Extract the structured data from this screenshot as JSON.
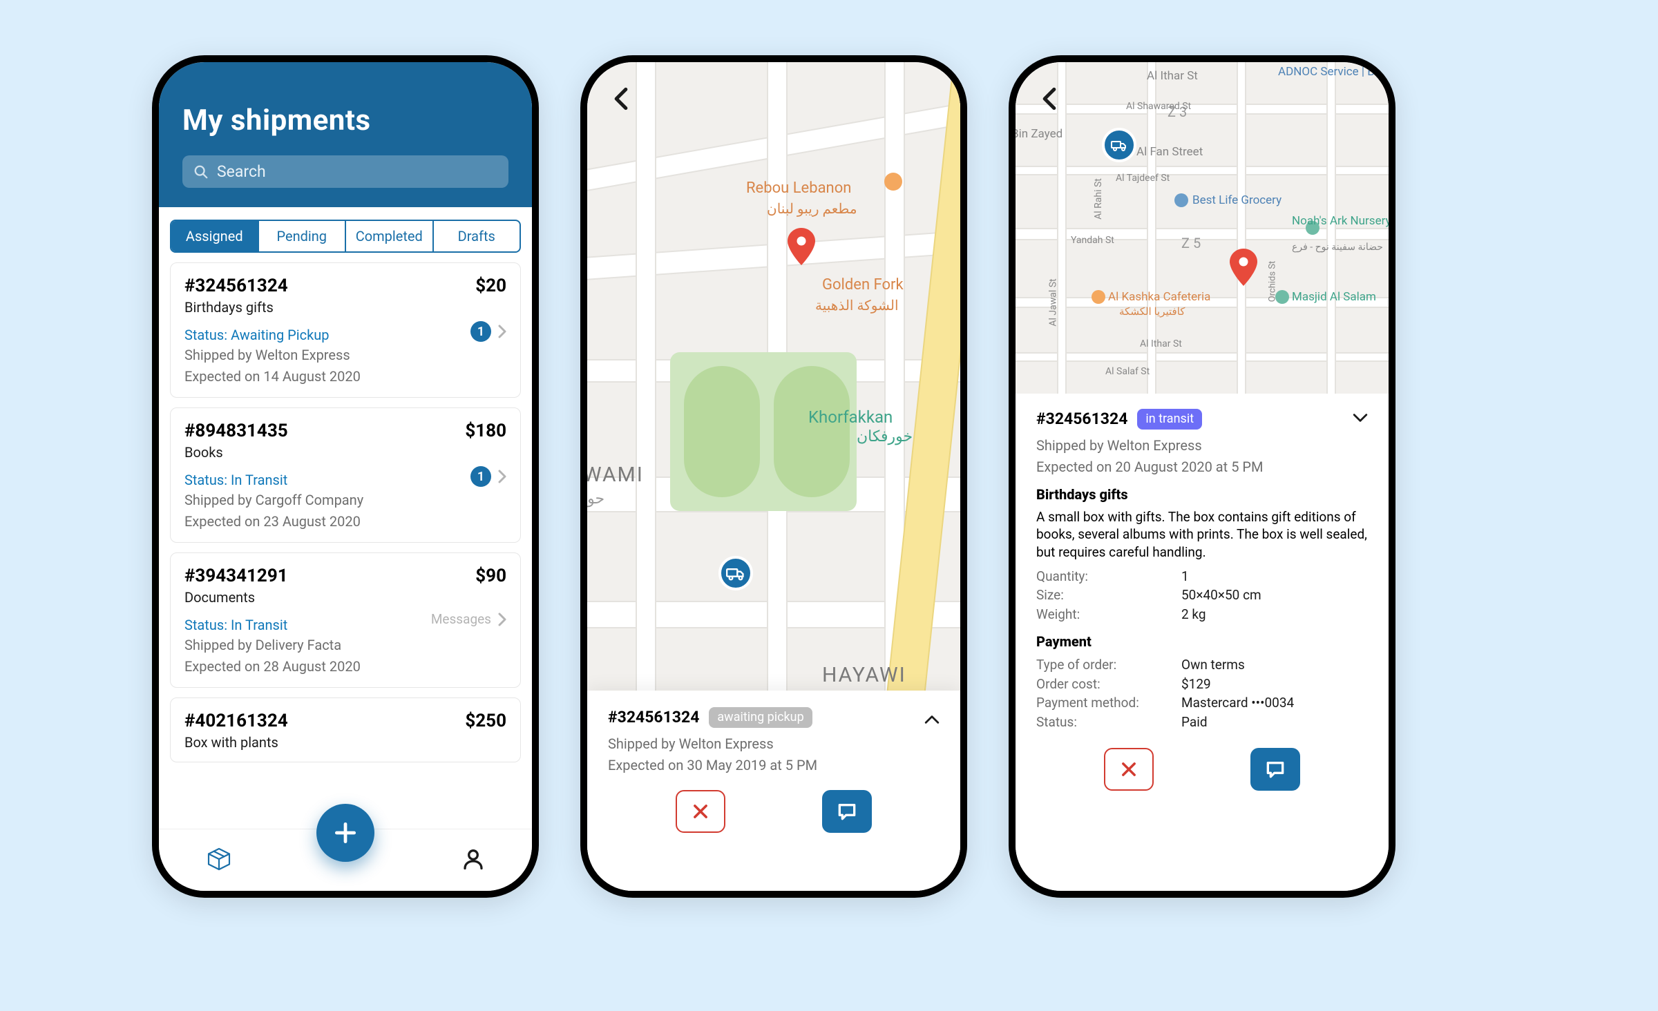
{
  "screen1": {
    "title": "My shipments",
    "search_placeholder": "Search",
    "tabs": [
      "Assigned",
      "Pending",
      "Completed",
      "Drafts"
    ],
    "active_tab_index": 0,
    "shipments": [
      {
        "id": "#324561324",
        "price": "$20",
        "desc": "Birthdays gifts",
        "status": "Status: Awaiting Pickup",
        "shipper": "Shipped by Welton Express",
        "expected": "Expected on 14 August 2020",
        "badge": "1"
      },
      {
        "id": "#894831435",
        "price": "$180",
        "desc": "Books",
        "status": "Status: In Transit",
        "shipper": "Shipped by Cargoff Company",
        "expected": "Expected on 23 August 2020",
        "badge": "1"
      },
      {
        "id": "#394341291",
        "price": "$90",
        "desc": "Documents",
        "status": "Status: In Transit",
        "shipper": "Shipped by Delivery Facta",
        "expected": "Expected on 28 August 2020",
        "right_label": "Messages"
      },
      {
        "id": "#402161324",
        "price": "$250",
        "desc": "Box with plants"
      }
    ]
  },
  "screen2": {
    "order_id": "#324561324",
    "status_pill": "awaiting pickup",
    "shipper": "Shipped by Welton Express",
    "expected": "Expected on 30 May 2019 at 5 PM",
    "map_places": {
      "rebou": "Rebou Lebanon",
      "rebou_ar": "مطعم ريبو لبنان",
      "golden_fork": "Golden Fork",
      "golden_fork_ar": "الشوكة الذهبية",
      "khorfakkan": "Khorfakkan",
      "khorfakkan_ar": "خورفكان",
      "wami": "WAMI",
      "wami_ar": "حوا",
      "hayawi": "HAYAWI"
    }
  },
  "screen3": {
    "order_id": "#324561324",
    "status_pill": "in transit",
    "shipper": "Shipped by Welton Express",
    "expected": "Expected on 20 August 2020 at 5 PM",
    "item_title": "Birthdays gifts",
    "item_desc": "A small box with gifts. The box contains gift editions of books, several albums with prints. The box is well sealed, but requires careful handling.",
    "spec": {
      "qty_label": "Quantity:",
      "qty": "1",
      "size_label": "Size:",
      "size": "50×40×50 cm",
      "weight_label": "Weight:",
      "weight": "2 kg"
    },
    "payment_heading": "Payment",
    "payment": {
      "type_label": "Type of order:",
      "type": "Own terms",
      "cost_label": "Order cost:",
      "cost": "$129",
      "method_label": "Payment method:",
      "method": "Mastercard •••0034",
      "status_label": "Status:",
      "status": "Paid"
    },
    "map_places": {
      "ithar": "Al Ithar St",
      "adnoc": "ADNOC Service | Bab Al Sharq",
      "z3": "Z 3",
      "bin_zayed": "Bin Zayed",
      "fan": "Al Fan Street",
      "tajdeef": "Al Tajdeef St",
      "bestlife": "Best Life Grocery",
      "noahs": "Noah's Ark Nursery - Br",
      "yandah": "Yandah St",
      "z5": "Z 5",
      "kashka": "Al Kashka Cafeteria",
      "kashka_ar": "كافتيريا الكشكة",
      "masjid": "Masjid Al Salam",
      "salaf": "Al Salaf St",
      "rahi": "Al Rahi St",
      "jawal": "Al Jawal St",
      "shawared": "Al Shawared St",
      "orchids": "Orchids St",
      "hadaeq": "حضانة سفينة نوح - فرع"
    }
  }
}
